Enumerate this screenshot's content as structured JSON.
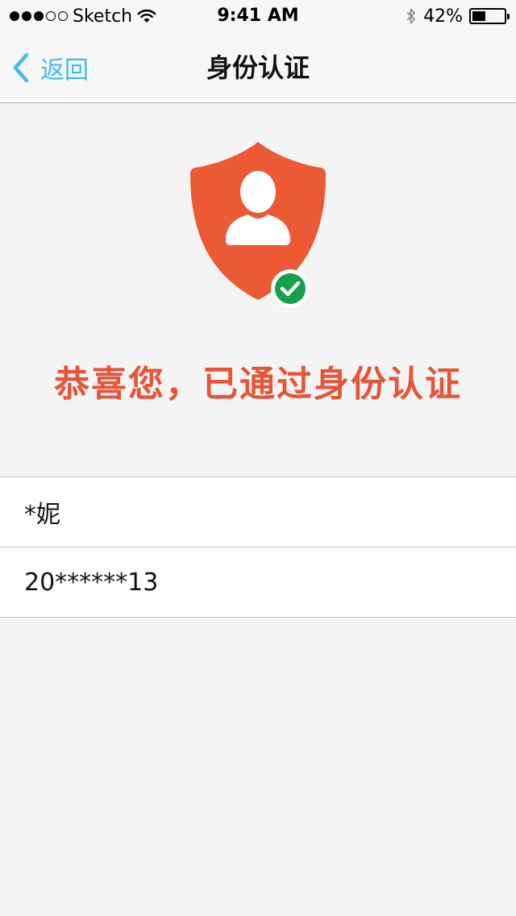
{
  "status_bar": {
    "signal_dots_filled": 3,
    "signal_dots_total": 5,
    "carrier": "Sketch",
    "time": "9:41 AM",
    "battery_percent_label": "42%",
    "battery_level": 0.42,
    "icons": [
      "wifi-icon",
      "bluetooth-icon",
      "battery-icon"
    ]
  },
  "nav": {
    "back_label": "返回",
    "title": "身份认证",
    "back_icon": "chevron-left-icon",
    "accent_color": "#41b9f0"
  },
  "verification": {
    "icon": "shield-user-check-icon",
    "shield_color": "#eb5a35",
    "check_color": "#16a04b",
    "message": "恭喜您，已通过身份认证",
    "message_color": "#e65537"
  },
  "info": {
    "name": "*妮",
    "id_number": "20******13"
  }
}
